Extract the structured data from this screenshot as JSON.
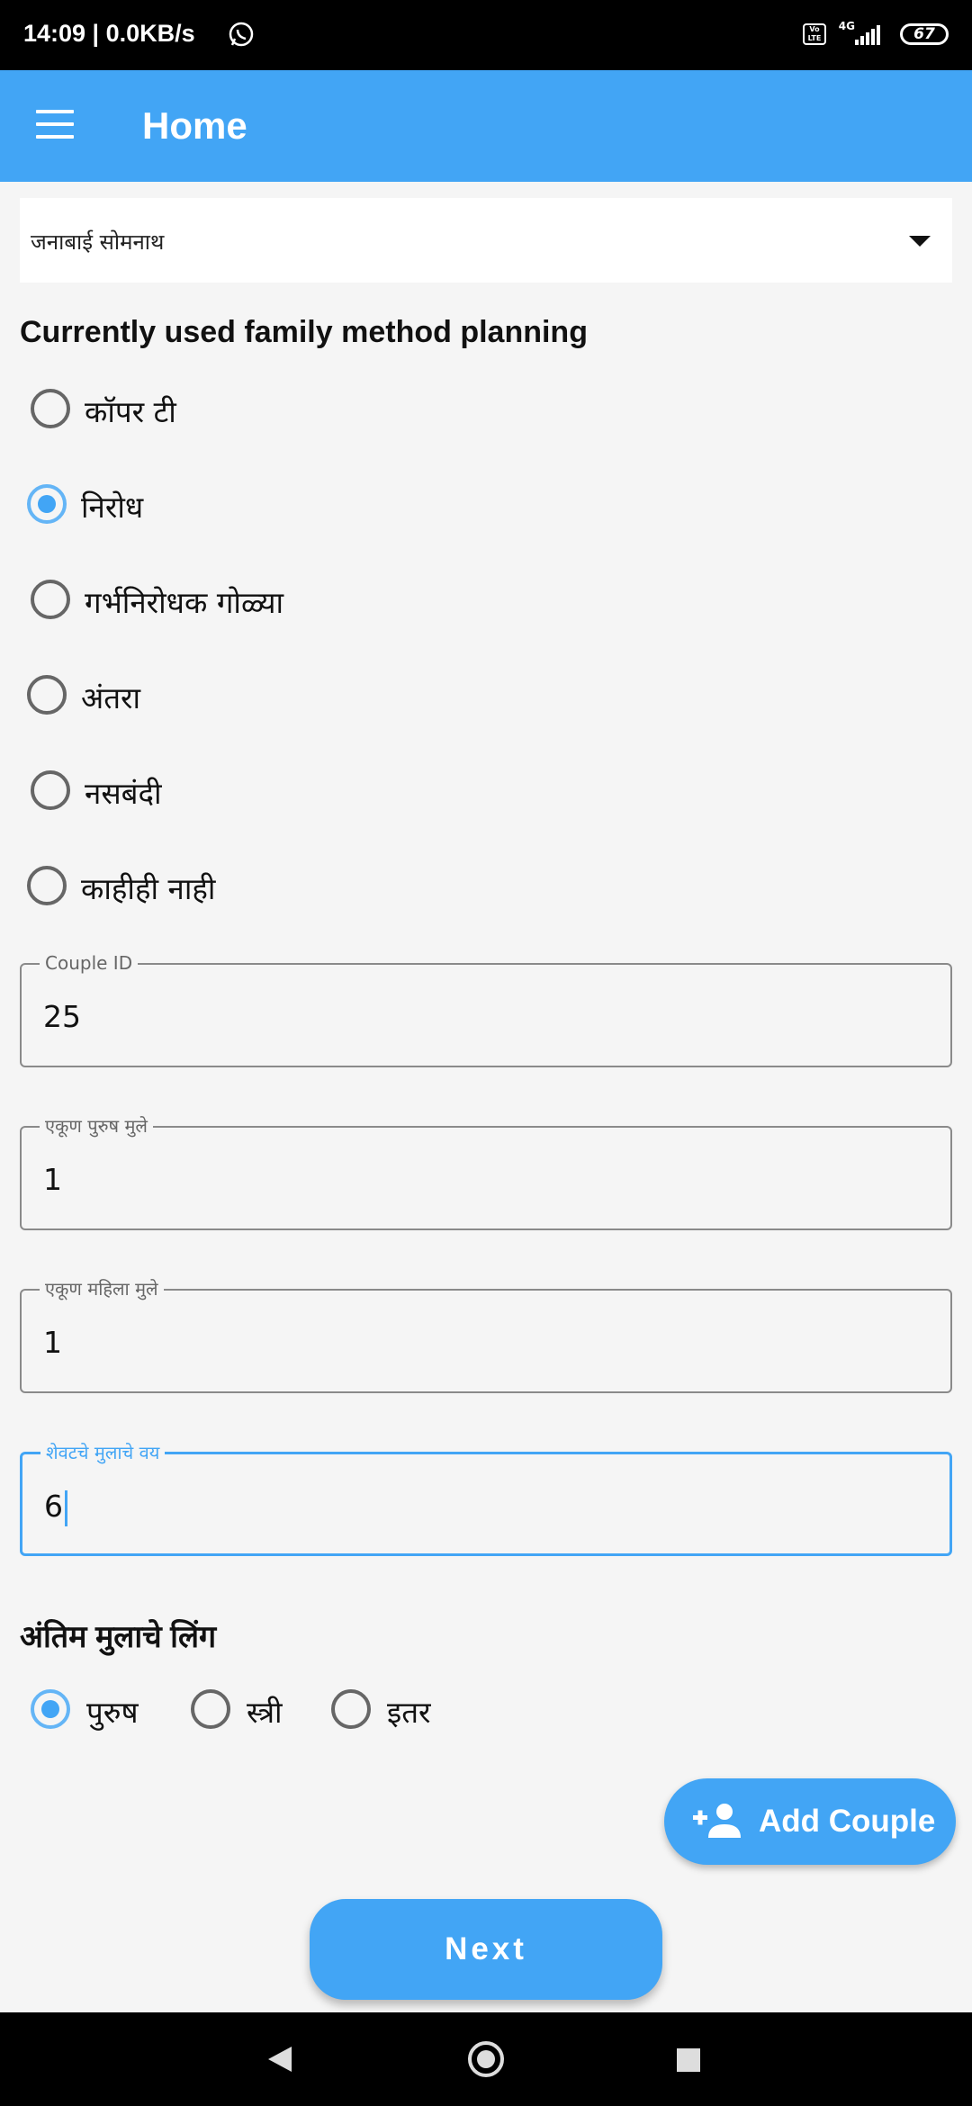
{
  "status_bar": {
    "time": "14:09 | 0.0KB/s",
    "network": "4G",
    "volte": "Vo LTE",
    "battery": "67",
    "icons": [
      "whatsapp-icon",
      "volte-icon",
      "signal-icon",
      "battery-icon"
    ]
  },
  "app_bar": {
    "title": "Home",
    "menu_icon": "hamburger-menu-icon"
  },
  "dropdown": {
    "selected": "जनाबाई सोमनाथ"
  },
  "family_planning": {
    "heading": "Currently used family method planning",
    "options": [
      {
        "label": "कॉपर टी",
        "checked": false
      },
      {
        "label": "निरोध",
        "checked": true
      },
      {
        "label": "गर्भनिरोधक गोळ्या",
        "checked": false
      },
      {
        "label": "अंतरा",
        "checked": false
      },
      {
        "label": "नसबंदी",
        "checked": false
      },
      {
        "label": "काहीही नाही",
        "checked": false
      }
    ]
  },
  "fields": {
    "couple_id": {
      "label": "Couple ID",
      "value": "25"
    },
    "male_children": {
      "label": "एकूण पुरुष मुले",
      "value": "1"
    },
    "female_children": {
      "label": "एकूण महिला मुले",
      "value": "1"
    },
    "last_child_age": {
      "label": "शेवटचे मुलाचे वय",
      "value": "6"
    }
  },
  "last_child_gender": {
    "heading": "अंतिम मुलाचे लिंग",
    "options": [
      {
        "label": "पुरुष",
        "checked": true
      },
      {
        "label": "स्त्री",
        "checked": false
      },
      {
        "label": "इतर",
        "checked": false
      }
    ]
  },
  "buttons": {
    "add_couple": "Add Couple",
    "add_couple_icon": "add-person-icon",
    "next": "Next"
  },
  "colors": {
    "primary": "#42a5f5",
    "background": "#f5f5f5"
  }
}
